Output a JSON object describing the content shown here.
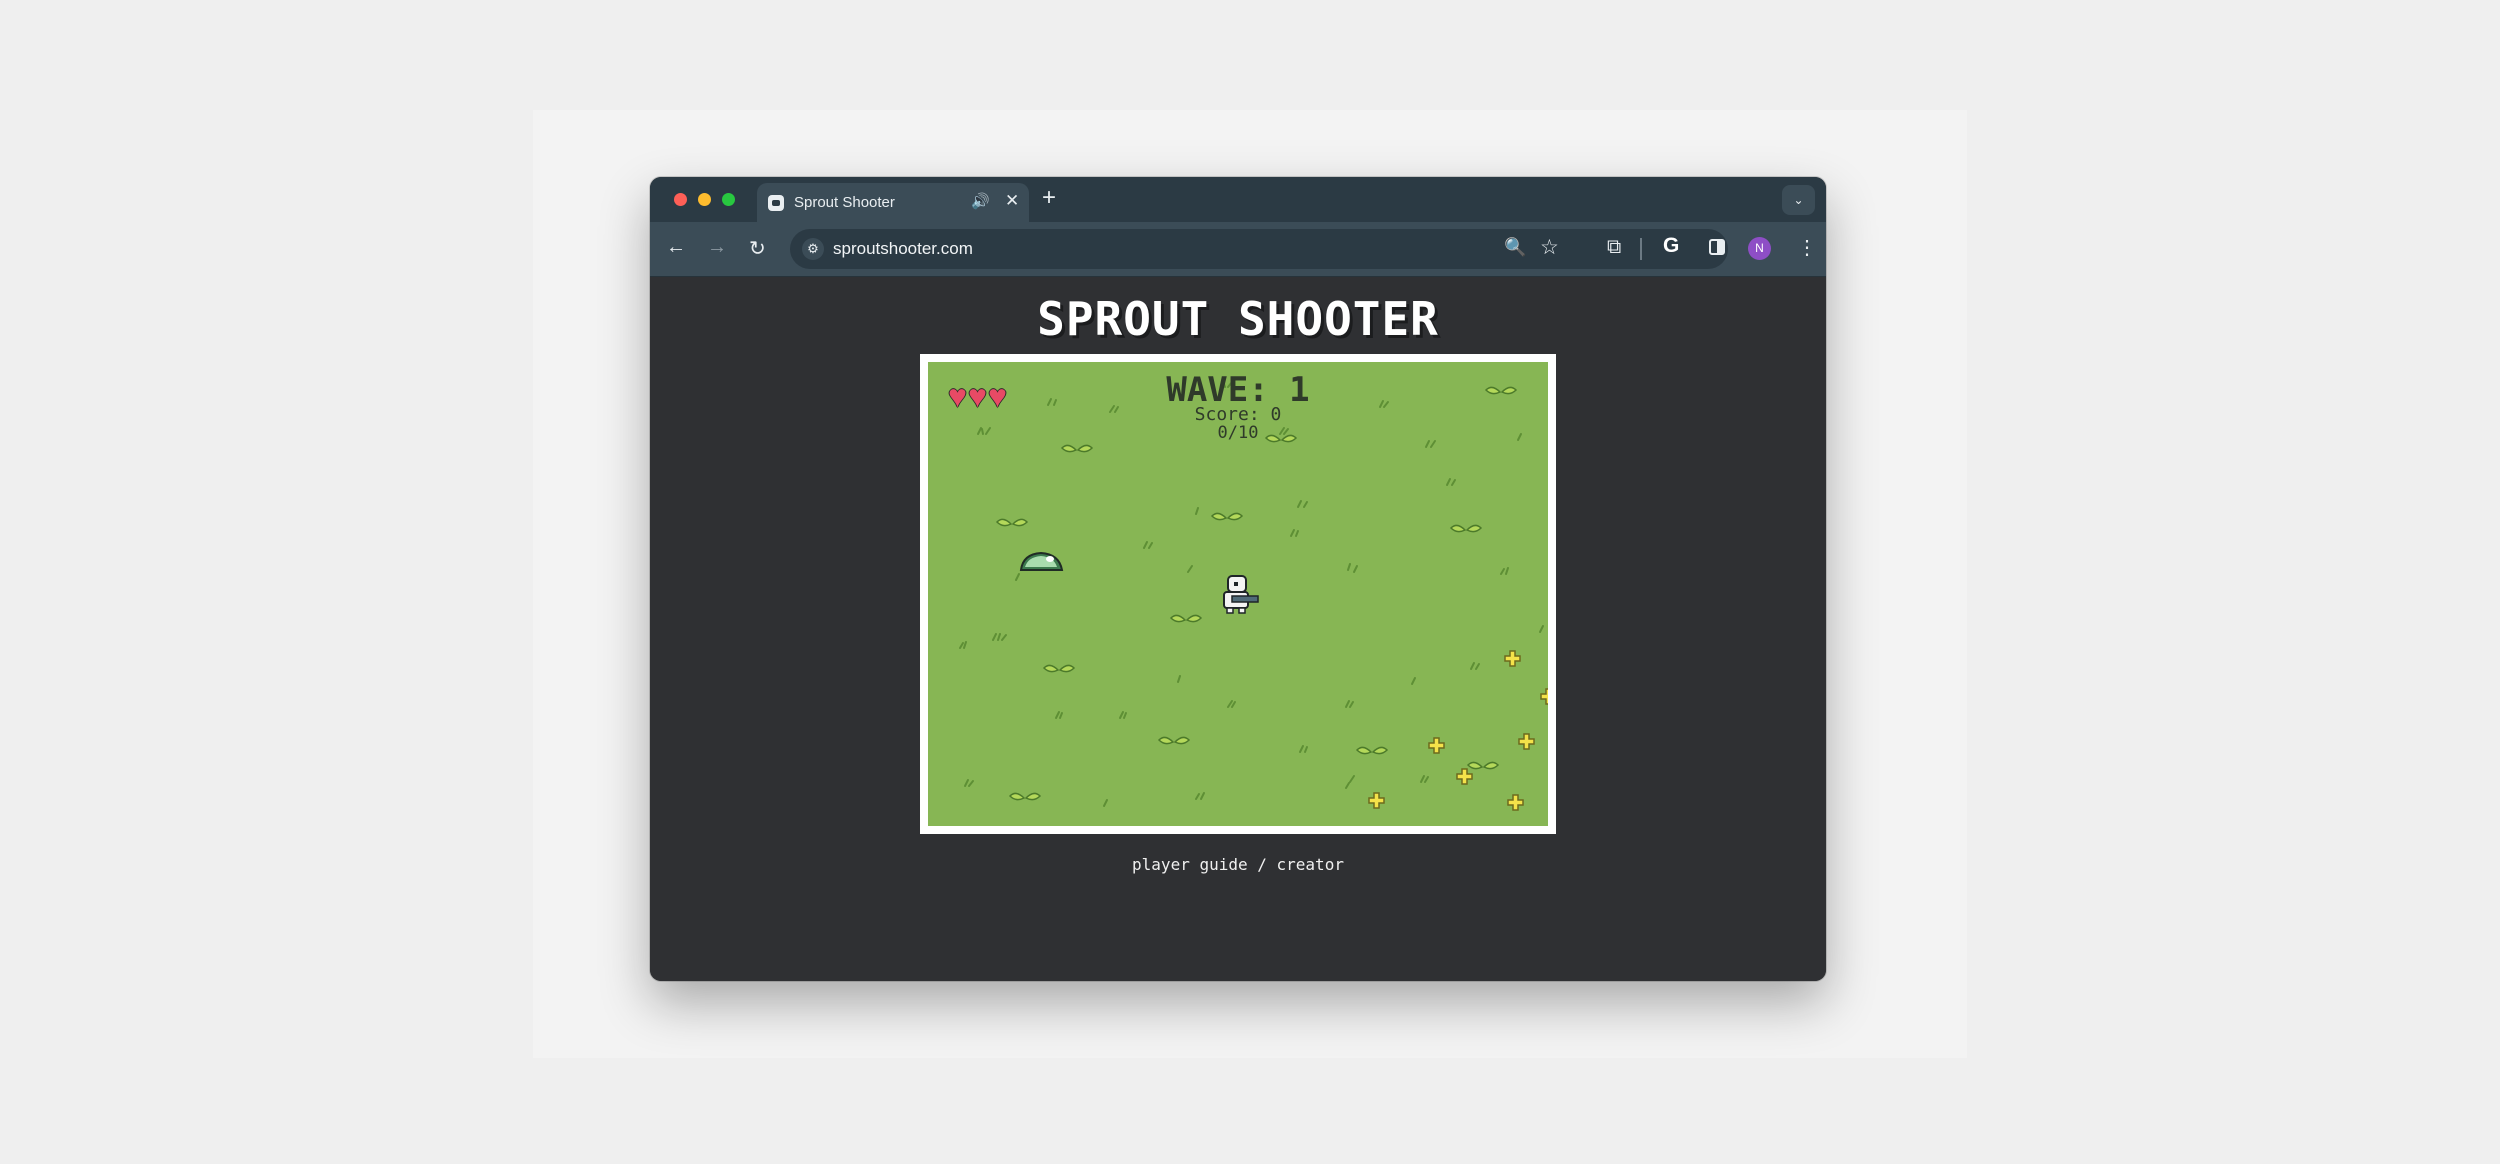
{
  "browser": {
    "tab_title": "Sprout Shooter",
    "tab_audio_icon": "🔊",
    "tab_close_icon": "✕",
    "new_tab_icon": "+",
    "tab_dropdown_icon": "⌄",
    "url": "sproutshooter.com",
    "back_icon": "←",
    "forward_icon": "→",
    "reload_icon": "↻",
    "site_settings_icon": "⚙",
    "zoom_icon": "🔍",
    "bookmark_icon": "☆",
    "extensions_icon": "⧉",
    "google_icon": "G",
    "profile_initial": "N",
    "menu_icon": "⋮"
  },
  "game": {
    "title": "SPROUT SHOOTER",
    "wave_label": "WAVE: 1",
    "score_label": "Score: 0",
    "kills_label": "0/10",
    "lives": 3,
    "heart_icon": "♥"
  },
  "footer": {
    "links_text": "player guide / creator"
  },
  "colors": {
    "grass": "#87b654",
    "heart": "#e84a65",
    "page_bg": "#2f3033",
    "chrome_bg": "#2b3a44"
  }
}
